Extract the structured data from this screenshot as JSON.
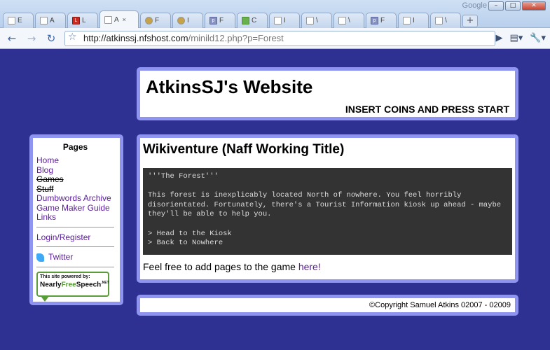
{
  "browser": {
    "brand": "Google",
    "tabs": [
      {
        "icon": "page",
        "label": "E",
        "active": false
      },
      {
        "icon": "page",
        "label": "A",
        "active": false
      },
      {
        "icon": "ld",
        "label": "L",
        "active": false
      },
      {
        "icon": "page",
        "label": "A",
        "active": true
      },
      {
        "icon": "owl",
        "label": "F",
        "active": false
      },
      {
        "icon": "owl",
        "label": "I",
        "active": false
      },
      {
        "icon": "php",
        "label": "F",
        "active": false
      },
      {
        "icon": "green",
        "label": "C",
        "active": false
      },
      {
        "icon": "page",
        "label": "I",
        "active": false
      },
      {
        "icon": "page",
        "label": "\\",
        "active": false
      },
      {
        "icon": "page",
        "label": "\\",
        "active": false
      },
      {
        "icon": "php",
        "label": "F",
        "active": false
      },
      {
        "icon": "page",
        "label": "I",
        "active": false
      },
      {
        "icon": "page",
        "label": "\\",
        "active": false
      }
    ],
    "url_host": "http://atkinssj.nfshost.com",
    "url_path": "/minild12.php?p=Forest"
  },
  "header": {
    "title": "AtkinsSJ's Website",
    "tagline": "INSERT COINS AND PRESS START"
  },
  "sidebar": {
    "title": "Pages",
    "links": [
      {
        "label": "Home",
        "strike": false
      },
      {
        "label": "Blog",
        "strike": false
      },
      {
        "label": "Games",
        "strike": true
      },
      {
        "label": "Stuff",
        "strike": true
      },
      {
        "label": "Dumbwords Archive",
        "strike": false
      },
      {
        "label": "Game Maker Guide",
        "strike": false
      },
      {
        "label": "Links",
        "strike": false
      }
    ],
    "login": "Login",
    "login_sep": "/",
    "register": "Register",
    "twitter": "Twitter",
    "badge_line1": "This site powered by:",
    "badge_line2a": "Nearly",
    "badge_line2b": "Free",
    "badge_line2c": "Speech",
    "badge_sup": ".NET"
  },
  "content": {
    "heading": "Wikiventure (Naff Working Title)",
    "game_text": "'''The Forest'''\n\nThis forest is inexplicably located North of nowhere. You feel horribly disorientated. Fortunately, there's a Tourist Information kiosk up ahead - maybe they'll be able to help you.\n\n> Head to the Kiosk\n> Back to Nowhere",
    "feel_text": "Feel free to add pages to the game ",
    "feel_link": "here!"
  },
  "footer": {
    "copyright": "©Copyright Samuel Atkins 02007 - 02009"
  },
  "colors": {
    "page_bg": "#2e3192",
    "panel_border": "#8f94f0",
    "link": "#5a1d96",
    "game_bg": "#333333"
  }
}
